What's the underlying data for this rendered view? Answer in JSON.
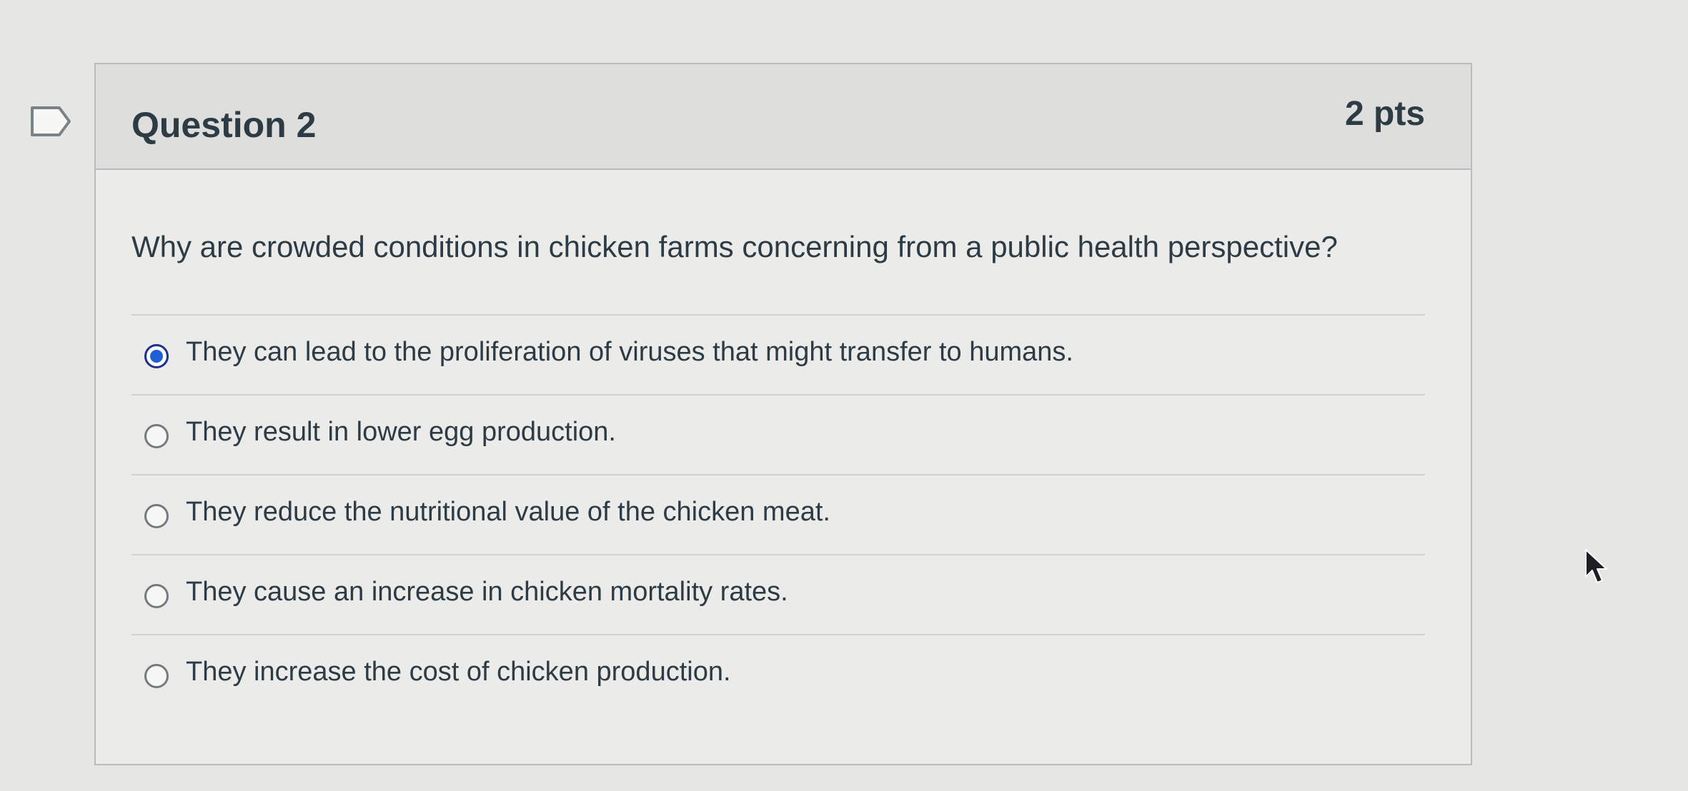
{
  "question": {
    "title": "Question 2",
    "points": "2 pts",
    "text": "Why are crowded conditions in chicken farms concerning from a public health perspective?"
  },
  "answers": [
    {
      "label": "They can lead to the proliferation of viruses that might transfer to humans.",
      "selected": true
    },
    {
      "label": "They result in lower egg production.",
      "selected": false
    },
    {
      "label": "They reduce the nutritional value of the chicken meat.",
      "selected": false
    },
    {
      "label": "They cause an increase in chicken mortality rates.",
      "selected": false
    },
    {
      "label": "They increase the cost of chicken production.",
      "selected": false
    }
  ],
  "icons": {
    "flag": "flag-icon",
    "radio": "radio-icon",
    "cursor": "mouse-cursor-icon"
  },
  "colors": {
    "selected_radio": "#1f5fd6",
    "text": "#2d3b45"
  }
}
